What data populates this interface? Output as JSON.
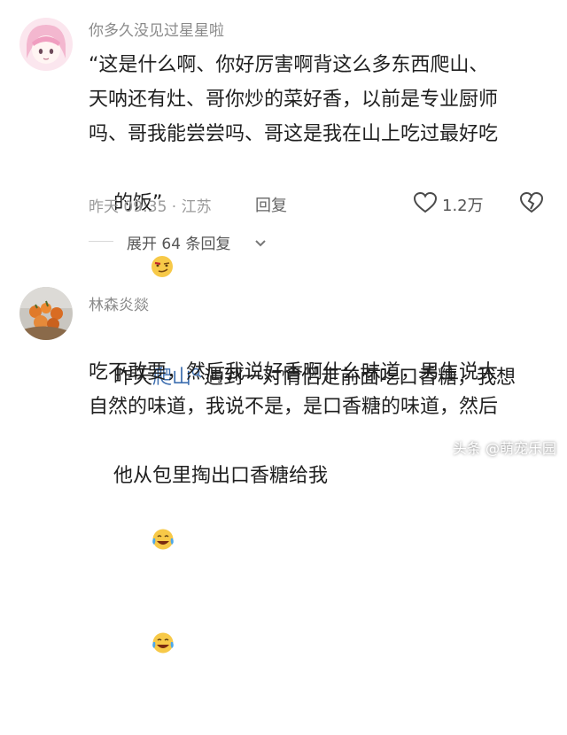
{
  "comment1": {
    "username": "你多久没见过星星啦",
    "lines": [
      "“这是什么啊、你好厉害啊背这么多东西爬山、",
      "天呐还有灶、哥你炒的菜好香，以前是专业厨师",
      "吗、哥我能尝尝吗、哥这是我在山上吃过最好吃",
      "的饭”"
    ],
    "time_location": "昨天 09:35 · 江苏",
    "reply_label": "回复",
    "like_count": "1.2万",
    "expand_label": "展开 64 条回复"
  },
  "comment2": {
    "username": "林森炎燚",
    "line1_prefix": "昨天",
    "line1_link": "爬山",
    "line1_suffix": "遇到一对情侣走前面吃口香糖，我想",
    "lines": [
      "吃不敢要，然后我说好香啊什么味道，男生说大",
      "自然的味道，我说不是，是口香糖的味道，然后",
      "他从包里掏出口香糖给我"
    ]
  },
  "watermark": "头条 @萌宠乐园"
}
